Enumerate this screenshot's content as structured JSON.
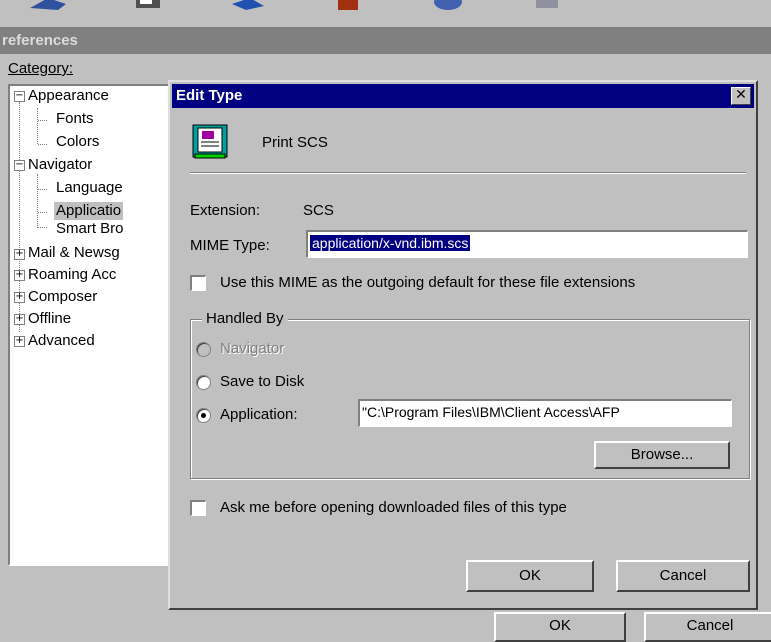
{
  "preferences": {
    "title": "references",
    "category_label": "Category:",
    "tree": [
      {
        "label": "Appearance",
        "level": 0,
        "toggle": "minus"
      },
      {
        "label": "Fonts",
        "level": 1
      },
      {
        "label": "Colors",
        "level": 1
      },
      {
        "label": "Navigator",
        "level": 0,
        "toggle": "minus"
      },
      {
        "label": "Language",
        "level": 1
      },
      {
        "label": "Applicatio",
        "level": 1,
        "selected": true
      },
      {
        "label": "Smart Bro",
        "level": 1
      },
      {
        "label": "Mail & Newsg",
        "level": 0,
        "toggle": "plus"
      },
      {
        "label": "Roaming Acc",
        "level": 0,
        "toggle": "plus"
      },
      {
        "label": "Composer",
        "level": 0,
        "toggle": "plus"
      },
      {
        "label": "Offline",
        "level": 0,
        "toggle": "plus"
      },
      {
        "label": "Advanced",
        "level": 0,
        "toggle": "plus"
      }
    ],
    "ok_label": "OK",
    "cancel_label": "Cancel"
  },
  "dialog": {
    "title": "Edit Type",
    "close_glyph": "✕",
    "type_name": "Print SCS",
    "extension_label": "Extension:",
    "extension_value": "SCS",
    "mime_label": "MIME Type:",
    "mime_value": "application/x-vnd.ibm.scs",
    "outgoing_default_label": "Use this MIME as the outgoing default for these file extensions",
    "handled_by_label": "Handled By",
    "navigator_label": "Navigator",
    "save_to_disk_label": "Save to Disk",
    "application_label": "Application:",
    "application_path": "\"C:\\Program Files\\IBM\\Client Access\\AFP",
    "browse_label": "Browse...",
    "ask_label": "Ask me before opening downloaded files of this type",
    "ok_label": "OK",
    "cancel_label": "Cancel",
    "selected_handler": "application"
  },
  "colors": {
    "title_active": "#000080",
    "title_inactive": "#808080",
    "face": "#c0c0c0"
  }
}
